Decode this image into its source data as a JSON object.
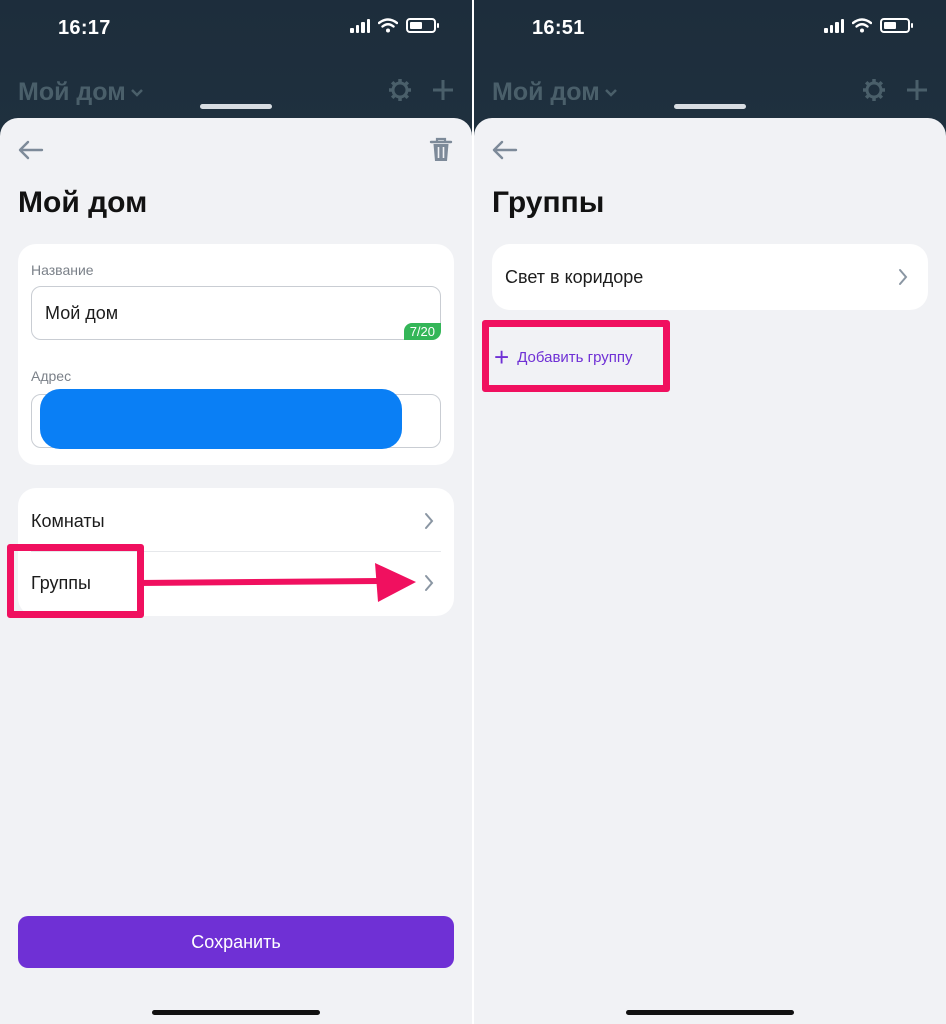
{
  "left_screen": {
    "status": {
      "time": "16:17"
    },
    "background_header": {
      "home_label": "Мой дом"
    },
    "title": "Мой дом",
    "name_field": {
      "label": "Название",
      "value": "Мой дом",
      "counter": "7/20"
    },
    "address_field": {
      "label": "Адрес"
    },
    "menu": [
      {
        "label": "Комнаты"
      },
      {
        "label": "Группы"
      }
    ],
    "save_label": "Сохранить"
  },
  "right_screen": {
    "status": {
      "time": "16:51"
    },
    "background_header": {
      "home_label": "Мой дом"
    },
    "title": "Группы",
    "groups": [
      {
        "label": "Свет в коридоре"
      }
    ],
    "add_group_label": "Добавить группу"
  },
  "colors": {
    "accent": "#6f30d5",
    "highlight": "#f0105f",
    "counter_green": "#34b658",
    "redaction_blue": "#0a7ff5"
  },
  "icons": [
    "back-arrow-icon",
    "trash-icon",
    "chevron-right-icon",
    "gear-icon",
    "plus-icon",
    "signal-icon",
    "wifi-icon",
    "battery-icon"
  ]
}
